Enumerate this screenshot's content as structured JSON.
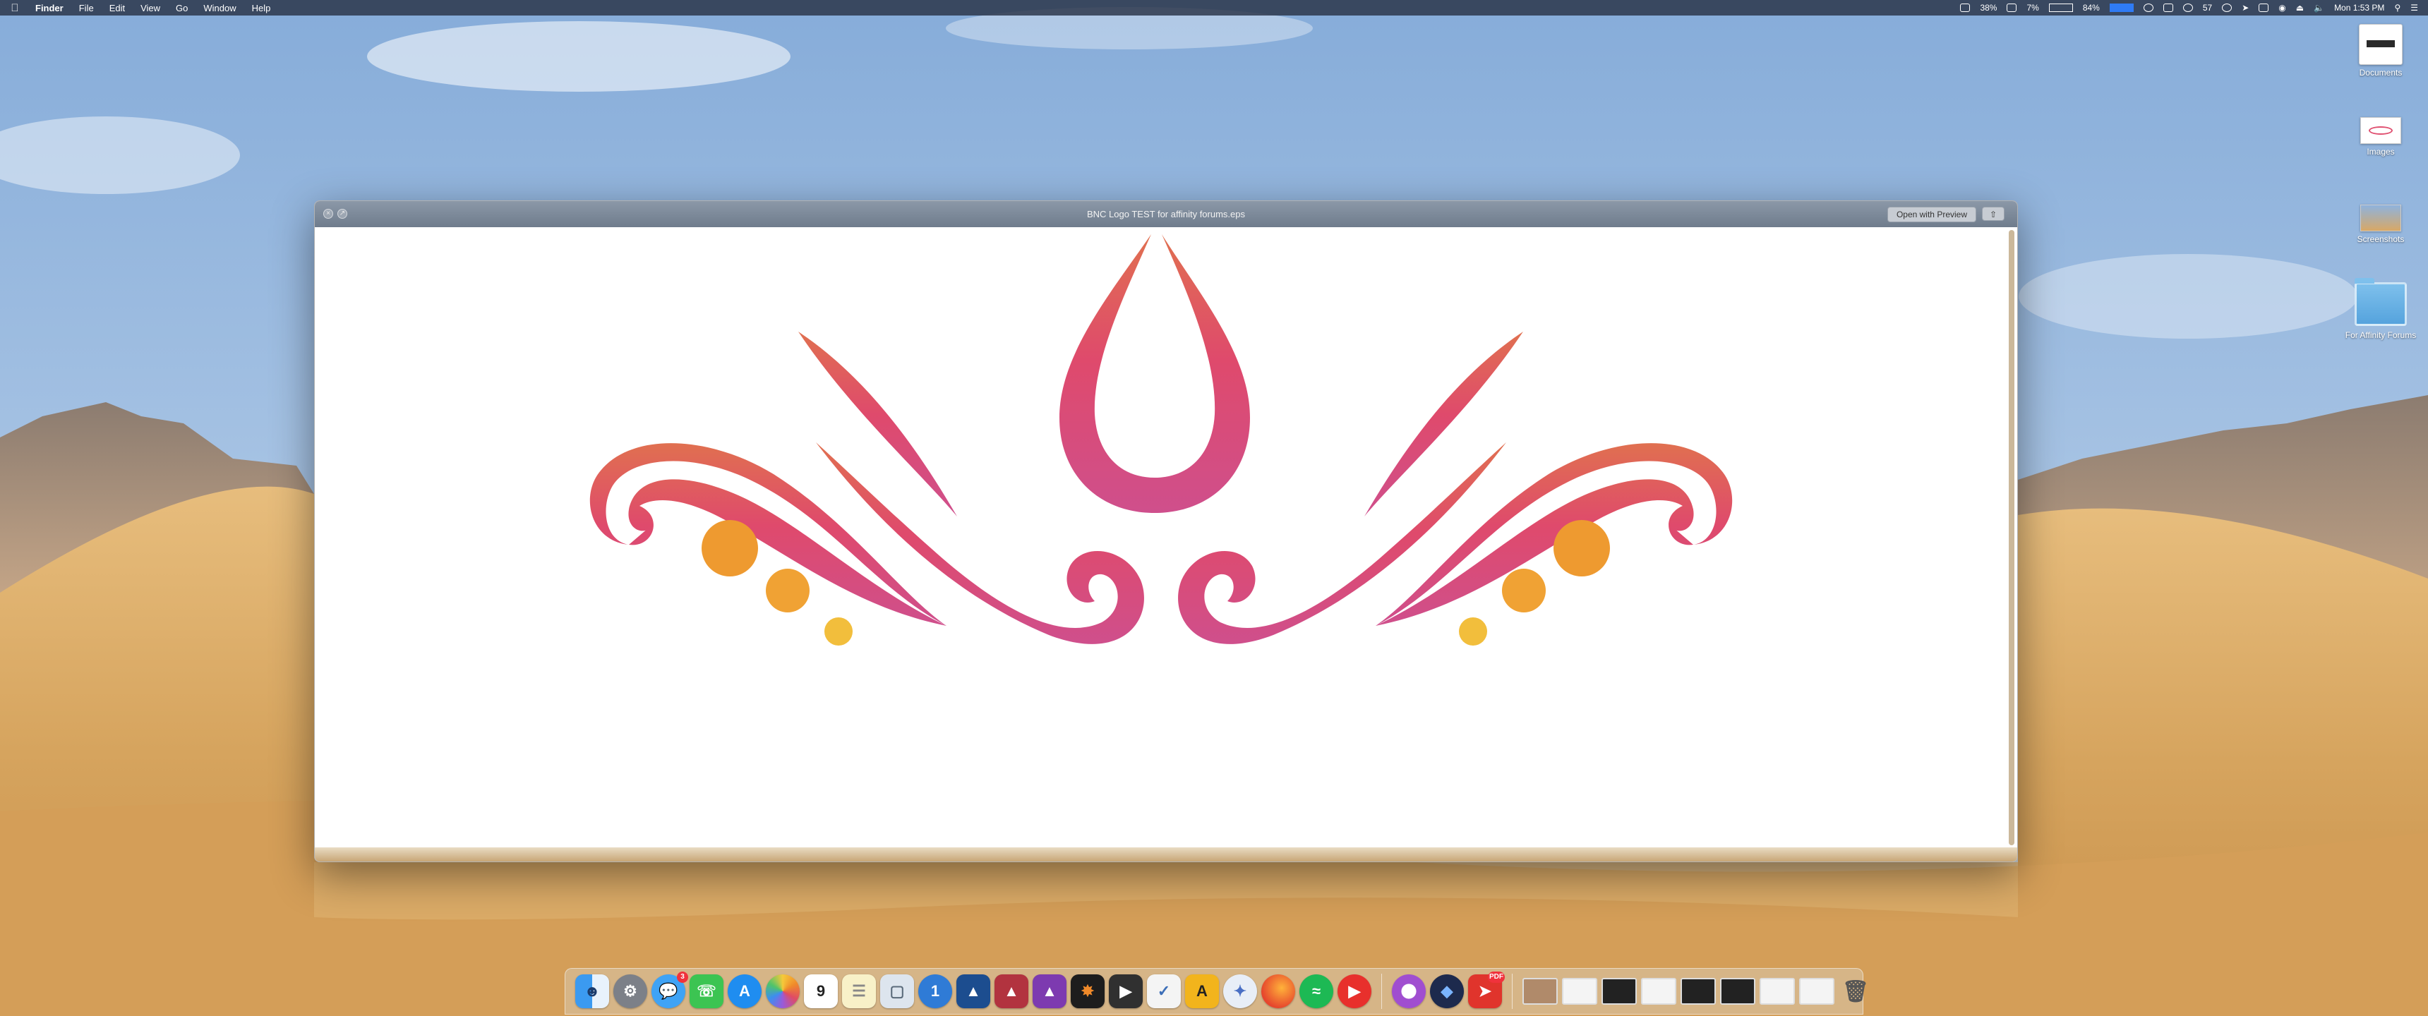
{
  "menubar": {
    "app_name": "Finder",
    "menus": [
      "File",
      "Edit",
      "View",
      "Go",
      "Window",
      "Help"
    ],
    "status": {
      "battery1": "38%",
      "cpu": "7%",
      "battery2": "84%",
      "notifications": "57",
      "clock": "Mon 1:53 PM"
    }
  },
  "desktop": {
    "items": [
      {
        "label": "Documents"
      },
      {
        "label": "Images"
      },
      {
        "label": "Screenshots"
      },
      {
        "label": "For Affinity Forums"
      }
    ]
  },
  "quicklook": {
    "title": "BNC Logo TEST for affinity forums.eps",
    "open_button": "Open with Preview",
    "share_icon": "share-icon"
  },
  "dock": {
    "icons": [
      "finder-icon",
      "system-preferences-icon",
      "messages-icon",
      "facetime-icon",
      "app-store-icon",
      "photos-icon",
      "calendar-icon",
      "notes-icon",
      "preview-icon",
      "1password-icon",
      "affinity-designer-icon",
      "affinity-publisher-icon",
      "affinity-photo-icon",
      "davinci-resolve-icon",
      "final-cut-icon",
      "omnifocus-icon",
      "vectorize-icon",
      "mail-bird-icon",
      "firefox-icon",
      "spotify-icon",
      "youtube-icon",
      "downloads-icon",
      "adobe-icon",
      "flashcut-icon"
    ],
    "calendar_day": "9",
    "messages_badge": "3",
    "acrobat_badge": "PDF"
  },
  "colors": {
    "gradient_top": "#e07050",
    "gradient_mid": "#df4a6c",
    "gradient_bottom": "#cf4f8c",
    "dot_orange": "#ee9a30",
    "dot_yellow": "#f2be3c"
  }
}
